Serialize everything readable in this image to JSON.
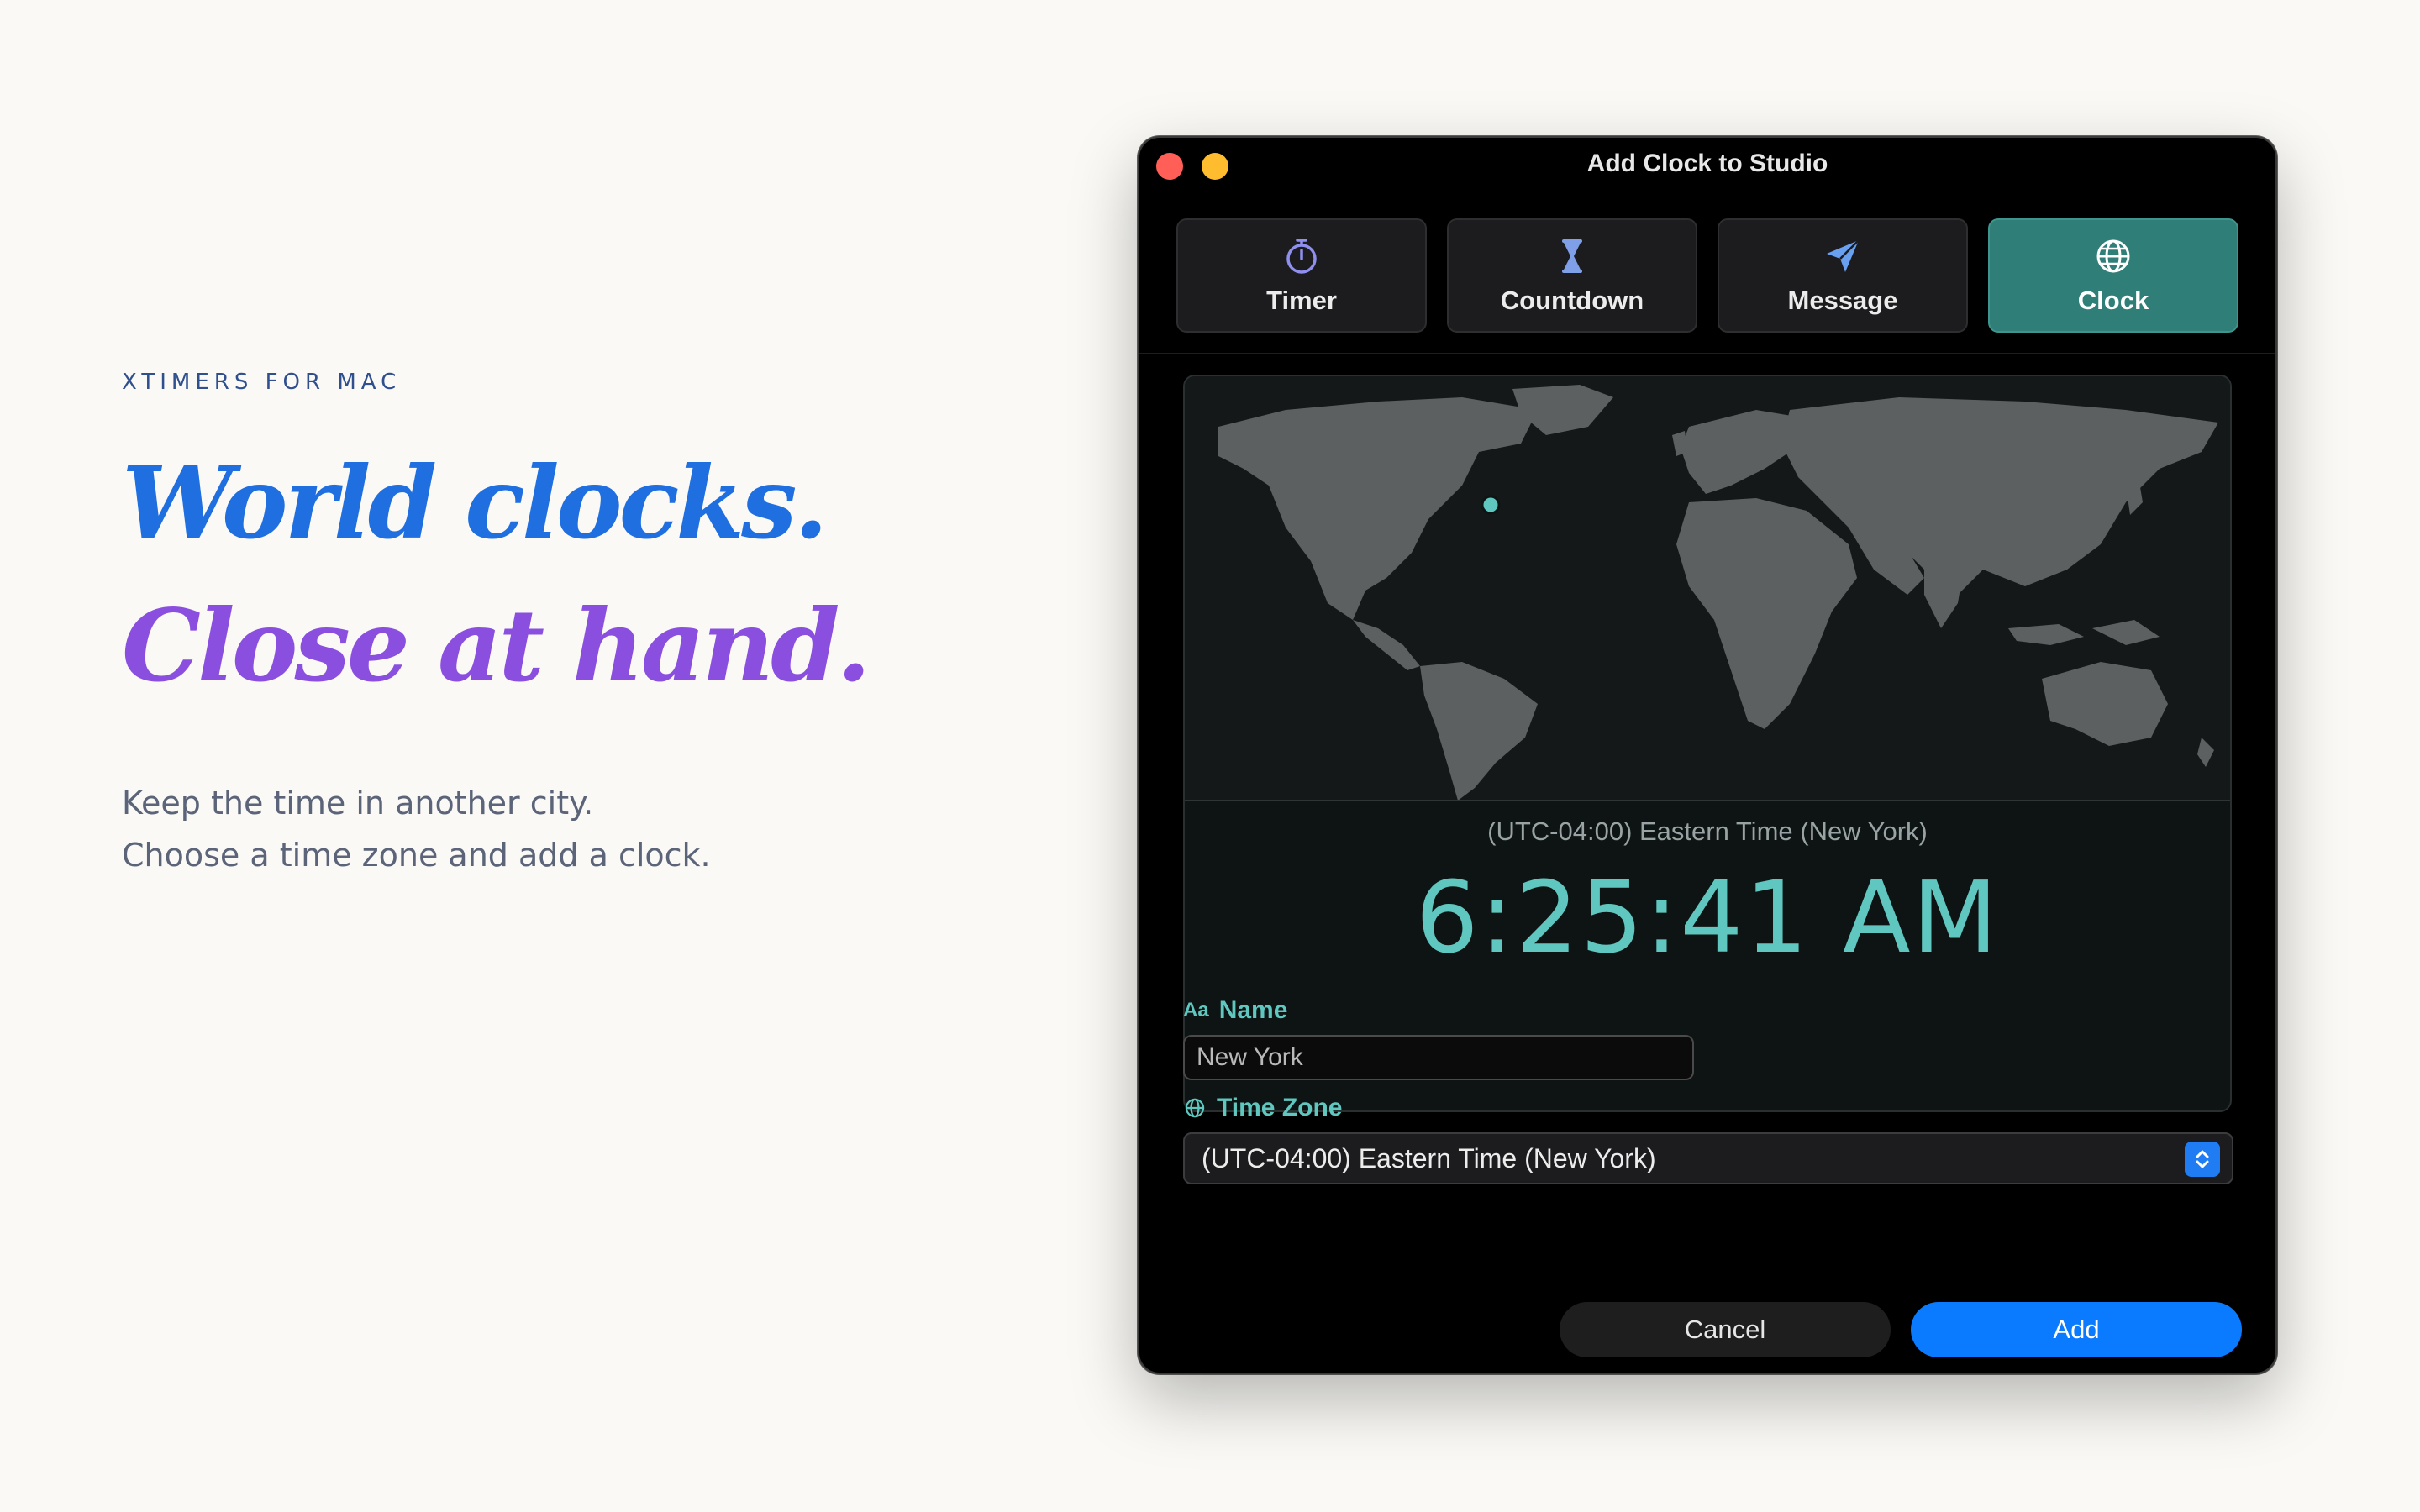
{
  "marketing": {
    "eyebrow": "XTIMERS FOR MAC",
    "headline_line1": "World clocks.",
    "headline_line2": "Close at hand.",
    "lead_line1": "Keep the time in another city.",
    "lead_line2": "Choose a time zone and add a clock.",
    "colors": {
      "headline1": "#1f6fe0",
      "headline2": "#8b4fe0",
      "eyebrow": "#2f4f8f"
    }
  },
  "window": {
    "title": "Add Clock to Studio",
    "tabs": [
      {
        "label": "Timer",
        "icon": "stopwatch-icon",
        "active": false
      },
      {
        "label": "Countdown",
        "icon": "hourglass-icon",
        "active": false
      },
      {
        "label": "Message",
        "icon": "paper-plane-icon",
        "active": false
      },
      {
        "label": "Clock",
        "icon": "globe-icon",
        "active": true
      }
    ],
    "clock": {
      "timezone_caption": "(UTC-04:00) Eastern Time (New York)",
      "time": "6:25:41 AM"
    },
    "name_field": {
      "label": "Name",
      "label_icon": "Aa",
      "value": "New York"
    },
    "timezone_field": {
      "label": "Time Zone",
      "selected": "(UTC-04:00) Eastern Time (New York)"
    },
    "buttons": {
      "cancel": "Cancel",
      "add": "Add"
    },
    "colors": {
      "accent": "#5fc7bf",
      "active_tab": "#2f7e78",
      "primary_button": "#0a7aff"
    }
  }
}
